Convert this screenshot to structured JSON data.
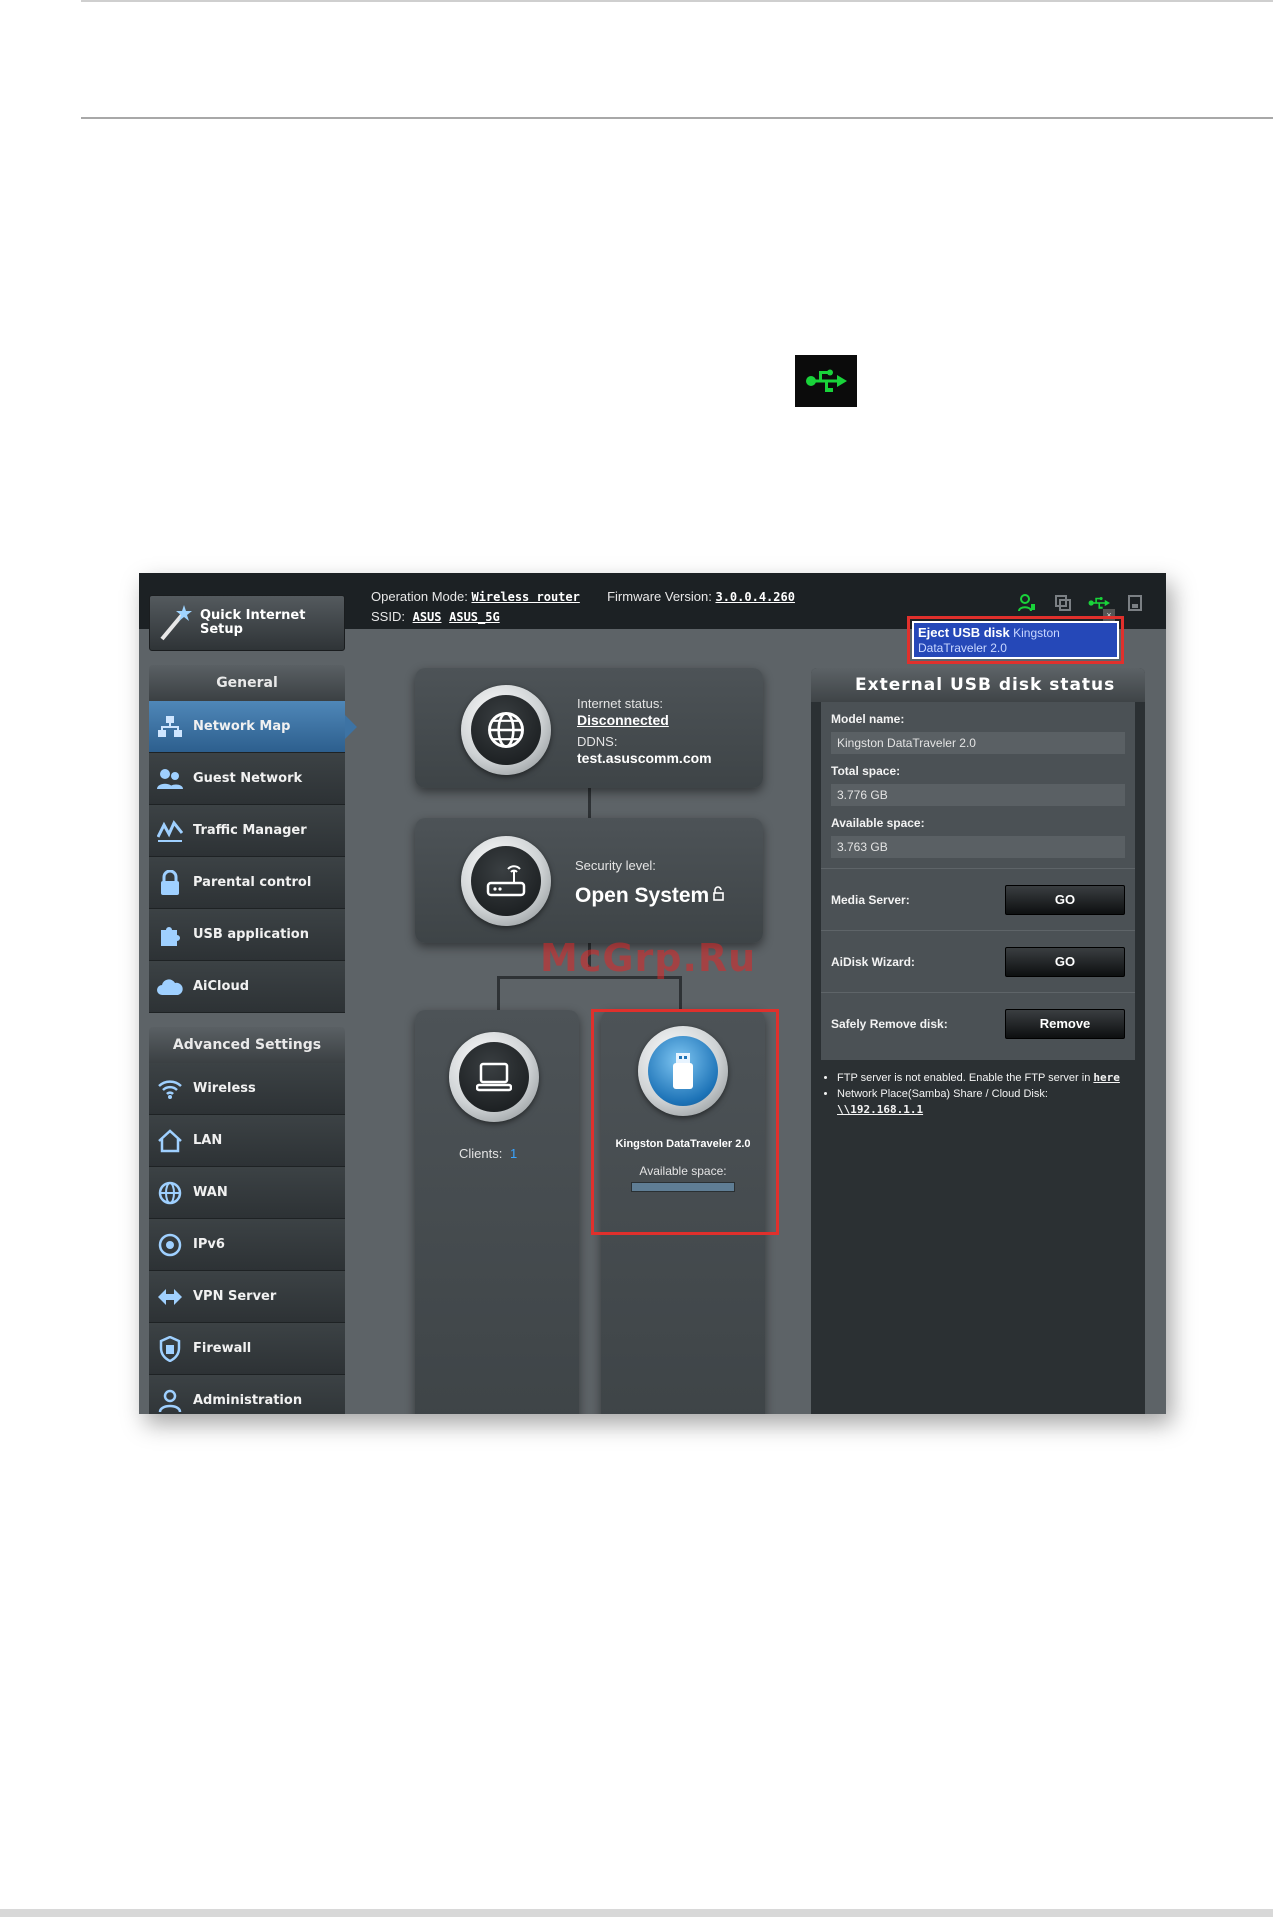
{
  "topbar": {
    "qis_label_1": "Quick Internet",
    "qis_label_2": "Setup",
    "op_mode_label": "Operation Mode:",
    "op_mode_value": "Wireless router",
    "firmware_label": "Firmware Version:",
    "firmware_value": "3.0.0.4.260",
    "ssid_label": "SSID:",
    "ssid_1": "ASUS",
    "ssid_2": "ASUS_5G",
    "status_icons": [
      "clients-icon",
      "printer-icon",
      "usb-icon",
      "lan-icon"
    ]
  },
  "popup": {
    "title": "Eject USB disk",
    "device": "Kingston DataTraveler 2.0"
  },
  "watermark": "McGrp.Ru",
  "sidebar": {
    "general": "General",
    "items": [
      {
        "label": "Network Map",
        "icon": "network-map-icon",
        "active": true
      },
      {
        "label": "Guest Network",
        "icon": "guest-network-icon",
        "active": false
      },
      {
        "label": "Traffic Manager",
        "icon": "traffic-manager-icon",
        "active": false
      },
      {
        "label": "Parental control",
        "icon": "lock-icon",
        "active": false
      },
      {
        "label": "USB application",
        "icon": "puzzle-icon",
        "active": false
      },
      {
        "label": "AiCloud",
        "icon": "cloud-icon",
        "active": false
      }
    ],
    "advanced": "Advanced Settings",
    "adv_items": [
      {
        "label": "Wireless",
        "icon": "wifi-icon"
      },
      {
        "label": "LAN",
        "icon": "home-icon"
      },
      {
        "label": "WAN",
        "icon": "globe-icon"
      },
      {
        "label": "IPv6",
        "icon": "ipv6-icon"
      },
      {
        "label": "VPN Server",
        "icon": "vpn-icon"
      },
      {
        "label": "Firewall",
        "icon": "shield-icon"
      },
      {
        "label": "Administration",
        "icon": "admin-icon"
      }
    ]
  },
  "map": {
    "internet_status_label": "Internet status:",
    "internet_status_value": "Disconnected",
    "ddns_label": "DDNS:",
    "ddns_value": "test.asuscomm.com",
    "security_label": "Security level:",
    "security_value": "Open System",
    "clients_label": "Clients:",
    "clients_value": "1",
    "usb_device_name": "Kingston DataTraveler 2.0",
    "usb_available_label": "Available space:"
  },
  "usb_status": {
    "title": "External USB disk status",
    "model_label": "Model name:",
    "model_value": "Kingston DataTraveler 2.0",
    "total_label": "Total space:",
    "total_value": "3.776 GB",
    "avail_label": "Available space:",
    "avail_value": "3.763 GB",
    "media_label": "Media Server:",
    "media_btn": "GO",
    "aidisk_label": "AiDisk Wizard:",
    "aidisk_btn": "GO",
    "remove_label": "Safely Remove disk:",
    "remove_btn": "Remove",
    "note1_text": "FTP server is not enabled. Enable the FTP server in",
    "note1_link": "here",
    "note2_text": "Network Place(Samba) Share / Cloud Disk:",
    "note2_link": "\\\\192.168.1.1"
  },
  "colors": {
    "usb_green": "#19d33a",
    "highlight_red": "#e0302c",
    "accent_blue": "#3d73a4"
  }
}
